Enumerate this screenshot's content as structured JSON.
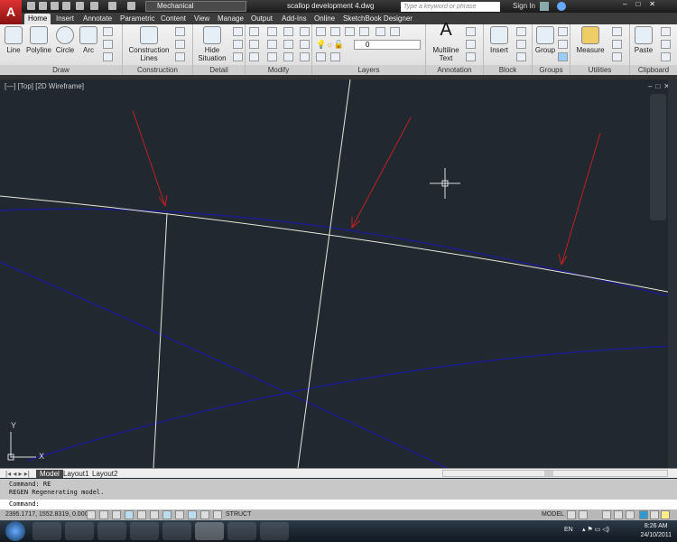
{
  "titlebar": {
    "app_icon": "A",
    "workspace": "Mechanical",
    "document": "scallop development 4.dwg",
    "search_placeholder": "Type a keyword or phrase",
    "sign_in": "Sign In"
  },
  "tabs": [
    "Home",
    "Insert",
    "Annotate",
    "Parametric",
    "Content",
    "View",
    "Manage",
    "Output",
    "Add-Ins",
    "Online",
    "SketchBook Designer"
  ],
  "ribbon": {
    "draw": {
      "title": "Draw",
      "tools": [
        "Line",
        "Polyline",
        "Circle",
        "Arc"
      ]
    },
    "construction": {
      "title": "Construction",
      "tool": "Construction Lines"
    },
    "detail": {
      "title": "Detail",
      "tool": "Hide Situation"
    },
    "modify": {
      "title": "Modify"
    },
    "layers": {
      "title": "Layers",
      "current_layer": "0"
    },
    "annotation": {
      "title": "Annotation",
      "tool": "Multiline Text"
    },
    "block": {
      "title": "Block",
      "tool": "Insert"
    },
    "groups": {
      "title": "Groups",
      "tool": "Group"
    },
    "utilities": {
      "title": "Utilities",
      "tool": "Measure"
    },
    "clipboard": {
      "title": "Clipboard",
      "tool": "Paste"
    }
  },
  "viewport": {
    "label": "[—] [Top] [2D Wireframe]",
    "ucs_x": "X",
    "ucs_y": "Y",
    "colors": {
      "background": "#212830",
      "white_line": "#e8e8d8",
      "blue_line": "#1c1c8c",
      "arrow": "#c02020"
    }
  },
  "layout_tabs": [
    "Model",
    "Layout1",
    "Layout2"
  ],
  "command": {
    "history": [
      "Command: RE",
      "REGEN Regenerating model."
    ],
    "prompt": "Command:"
  },
  "status": {
    "coordinates": "2395.1717, 1552.8319, 0.0000",
    "struct": "STRUCT",
    "model": "MODEL"
  },
  "taskbar": {
    "language": "EN",
    "time": "8:26 AM",
    "date": "24/10/2011"
  }
}
